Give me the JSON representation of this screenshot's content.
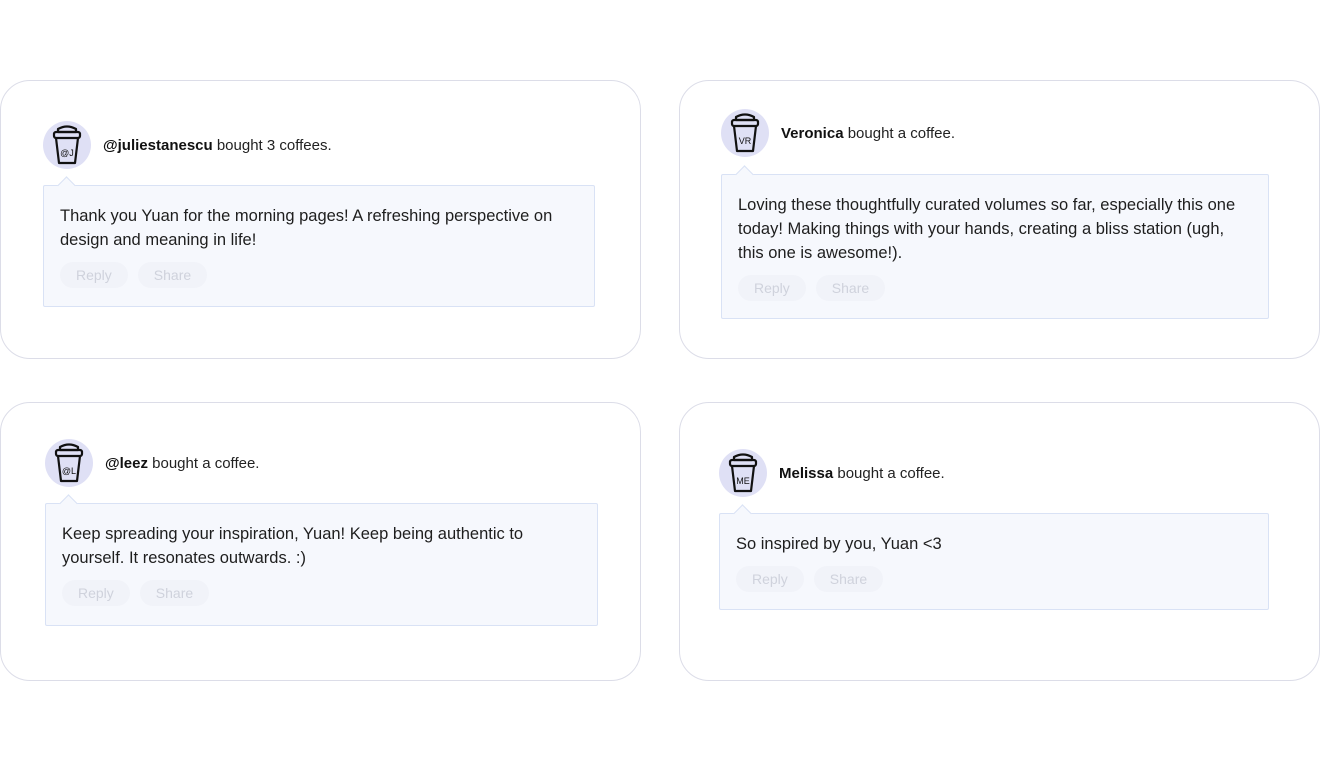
{
  "supporters": [
    {
      "name": "@juliestanescu",
      "action": " bought 3 coffees.",
      "initials": "@J",
      "message": "Thank you Yuan for the morning pages! A refreshing perspective on design and meaning in life!",
      "reply_label": "Reply",
      "share_label": "Share"
    },
    {
      "name": "Veronica",
      "action": " bought a coffee.",
      "initials": "VR",
      "message": "Loving these thoughtfully curated volumes so far, especially this one today! Making things with your hands, creating a bliss station (ugh, this one is awesome!).",
      "reply_label": "Reply",
      "share_label": "Share"
    },
    {
      "name": "@leez",
      "action": " bought a coffee.",
      "initials": "@L",
      "message": "Keep spreading your inspiration, Yuan! Keep being authentic to yourself. It resonates outwards. :)",
      "reply_label": "Reply",
      "share_label": "Share"
    },
    {
      "name": "Melissa",
      "action": " bought a coffee.",
      "initials": "ME",
      "message": "So inspired by you, Yuan <3",
      "reply_label": "Reply",
      "share_label": "Share"
    }
  ],
  "colors": {
    "avatar_bg": "#dfe0f5",
    "bubble_bg": "#f6f8fd",
    "card_border": "#dcdde8",
    "action_text": "#cfd2dc"
  },
  "icons": {
    "avatar": "coffee-cup-icon"
  }
}
